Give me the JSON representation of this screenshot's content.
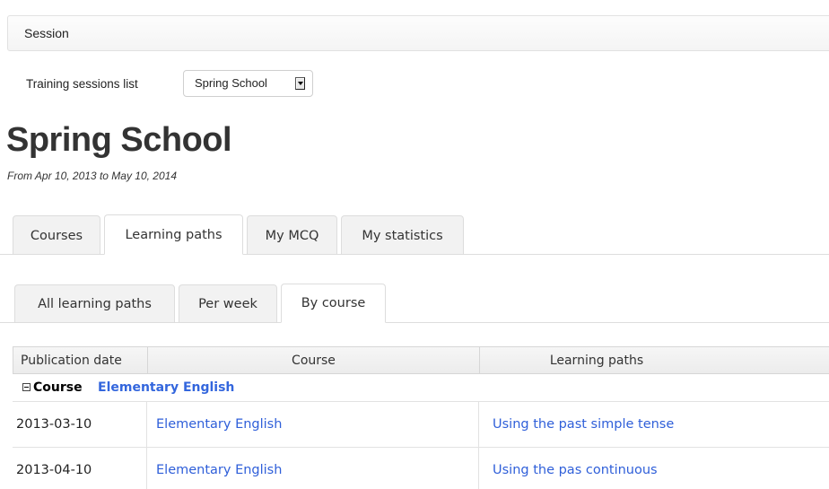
{
  "session_bar": {
    "title": "Session"
  },
  "sessions_selector": {
    "label": "Training sessions list",
    "selected": "Spring School"
  },
  "session": {
    "title": "Spring School",
    "subtitle": "From Apr 10, 2013 to May 10, 2014"
  },
  "main_tabs": [
    {
      "label": "Courses",
      "active": false
    },
    {
      "label": "Learning paths",
      "active": true
    },
    {
      "label": "My MCQ",
      "active": false
    },
    {
      "label": "My statistics",
      "active": false
    }
  ],
  "sub_tabs": [
    {
      "label": "All learning paths",
      "active": false
    },
    {
      "label": "Per week",
      "active": false
    },
    {
      "label": "By course",
      "active": true
    }
  ],
  "table": {
    "columns": [
      "Publication date",
      "Course",
      "Learning paths"
    ],
    "group": {
      "label": "Course",
      "course": "Elementary English"
    },
    "rows": [
      {
        "date": "2013-03-10",
        "course": "Elementary English",
        "learning_path": "Using the past simple tense"
      },
      {
        "date": "2013-04-10",
        "course": "Elementary English",
        "learning_path": "Using the pas continuous"
      }
    ]
  },
  "colors": {
    "link": "#2f5fd9",
    "group_link": "#3366dd",
    "tab_inactive_bg": "#f2f2f2",
    "border": "#dddddd"
  }
}
